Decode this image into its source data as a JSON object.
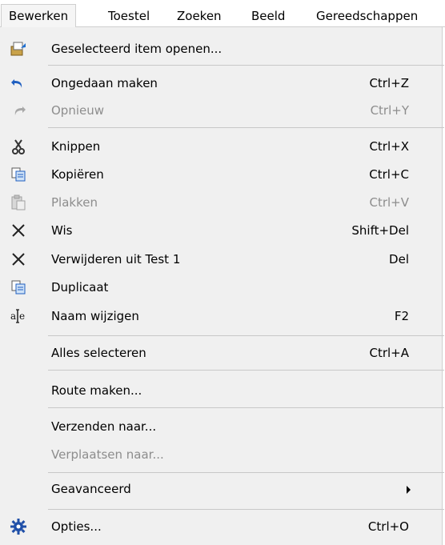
{
  "menubar": {
    "items": [
      {
        "label": "Bewerken"
      },
      {
        "label": "Toestel"
      },
      {
        "label": "Zoeken"
      },
      {
        "label": "Beeld"
      },
      {
        "label": "Gereedschappen"
      }
    ]
  },
  "menu": {
    "items": [
      {
        "label": "Geselecteerd item openen...",
        "shortcut": "",
        "icon": "open-item-icon",
        "enabled": true
      },
      {
        "label": "Ongedaan maken",
        "shortcut": "Ctrl+Z",
        "icon": "undo-icon",
        "enabled": true
      },
      {
        "label": "Opnieuw",
        "shortcut": "Ctrl+Y",
        "icon": "redo-icon",
        "enabled": false
      },
      {
        "label": "Knippen",
        "shortcut": "Ctrl+X",
        "icon": "scissors-icon",
        "enabled": true
      },
      {
        "label": "Kopiëren",
        "shortcut": "Ctrl+C",
        "icon": "copy-icon",
        "enabled": true
      },
      {
        "label": "Plakken",
        "shortcut": "Ctrl+V",
        "icon": "paste-icon",
        "enabled": false
      },
      {
        "label": "Wis",
        "shortcut": "Shift+Del",
        "icon": "x-icon",
        "enabled": true
      },
      {
        "label": "Verwijderen uit Test 1",
        "shortcut": "Del",
        "icon": "x-icon",
        "enabled": true
      },
      {
        "label": "Duplicaat",
        "shortcut": "",
        "icon": "duplicate-icon",
        "enabled": true
      },
      {
        "label": "Naam wijzigen",
        "shortcut": "F2",
        "icon": "rename-icon",
        "enabled": true
      },
      {
        "label": "Alles selecteren",
        "shortcut": "Ctrl+A",
        "icon": "",
        "enabled": true
      },
      {
        "label": "Route maken...",
        "shortcut": "",
        "icon": "",
        "enabled": true
      },
      {
        "label": "Verzenden naar...",
        "shortcut": "",
        "icon": "",
        "enabled": true
      },
      {
        "label": "Verplaatsen naar...",
        "shortcut": "",
        "icon": "",
        "enabled": false
      },
      {
        "label": "Geavanceerd",
        "shortcut": "",
        "icon": "submenu-arrow-icon",
        "enabled": true
      },
      {
        "label": "Opties...",
        "shortcut": "Ctrl+O",
        "icon": "gear-icon",
        "enabled": true
      }
    ]
  }
}
